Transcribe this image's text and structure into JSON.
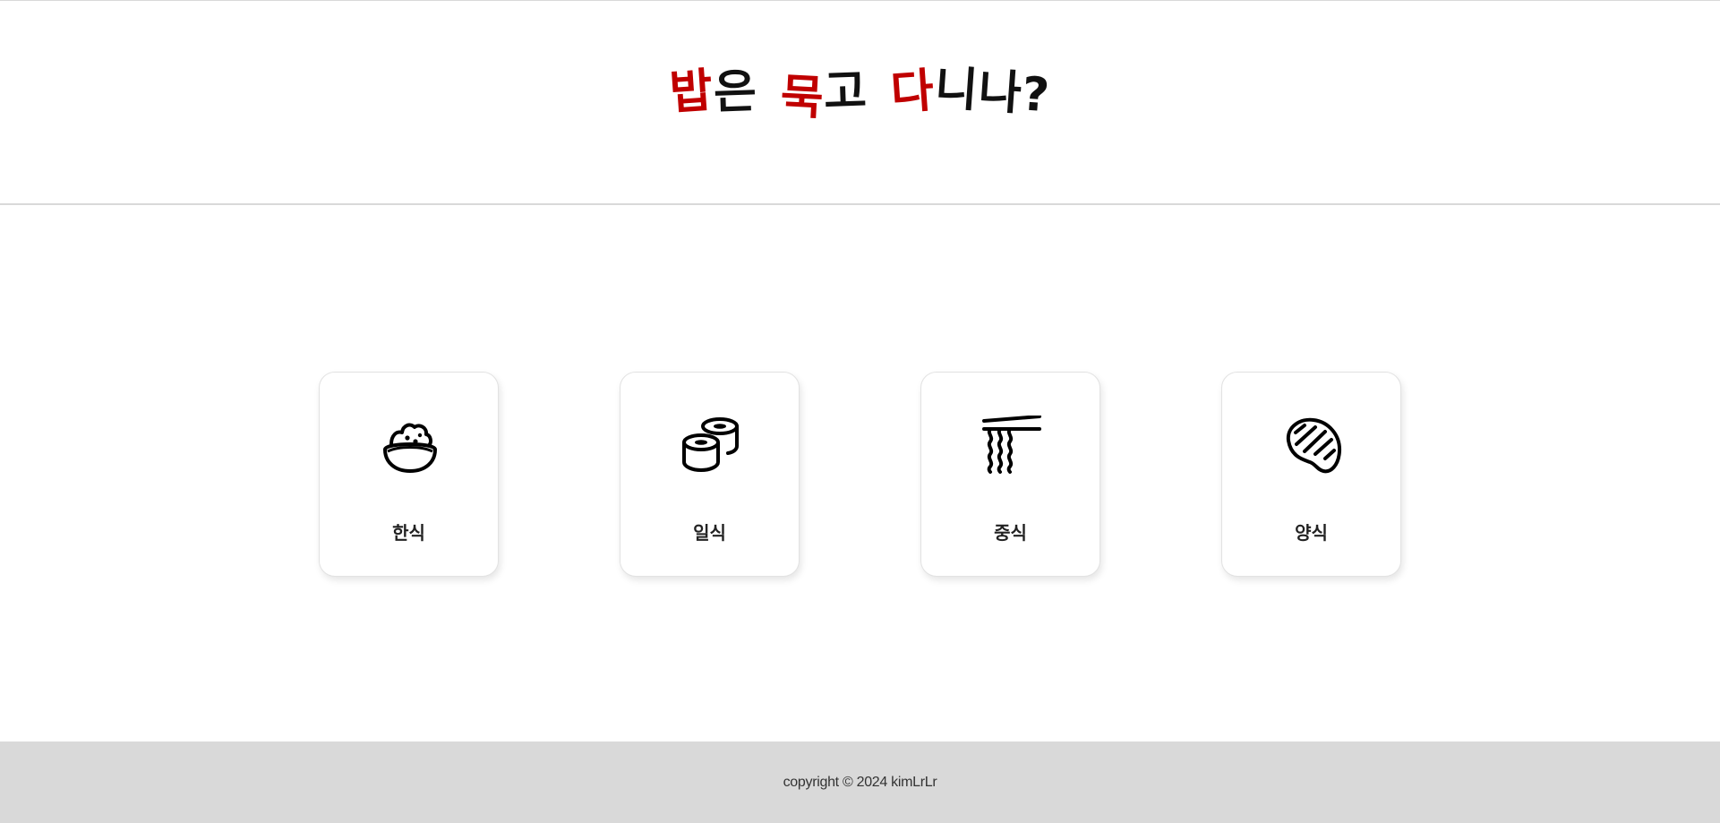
{
  "header": {
    "logo_parts": [
      {
        "text": "밥",
        "color": "#c00000"
      },
      {
        "text": "은",
        "color": "#111111"
      },
      {
        "text": "묵",
        "color": "#c00000"
      },
      {
        "text": "고",
        "color": "#111111"
      },
      {
        "text": "다",
        "color": "#c00000"
      },
      {
        "text": "니나?",
        "color": "#111111"
      }
    ]
  },
  "categories": [
    {
      "label": "한식",
      "icon": "rice-bowl-icon"
    },
    {
      "label": "일식",
      "icon": "sushi-roll-icon"
    },
    {
      "label": "중식",
      "icon": "noodles-chopsticks-icon"
    },
    {
      "label": "양식",
      "icon": "steak-icon"
    }
  ],
  "footer": {
    "copyright": "copyright © 2024 kimLrLr"
  },
  "colors": {
    "accent": "#c00000",
    "footer_bg": "#d9d9d9"
  }
}
